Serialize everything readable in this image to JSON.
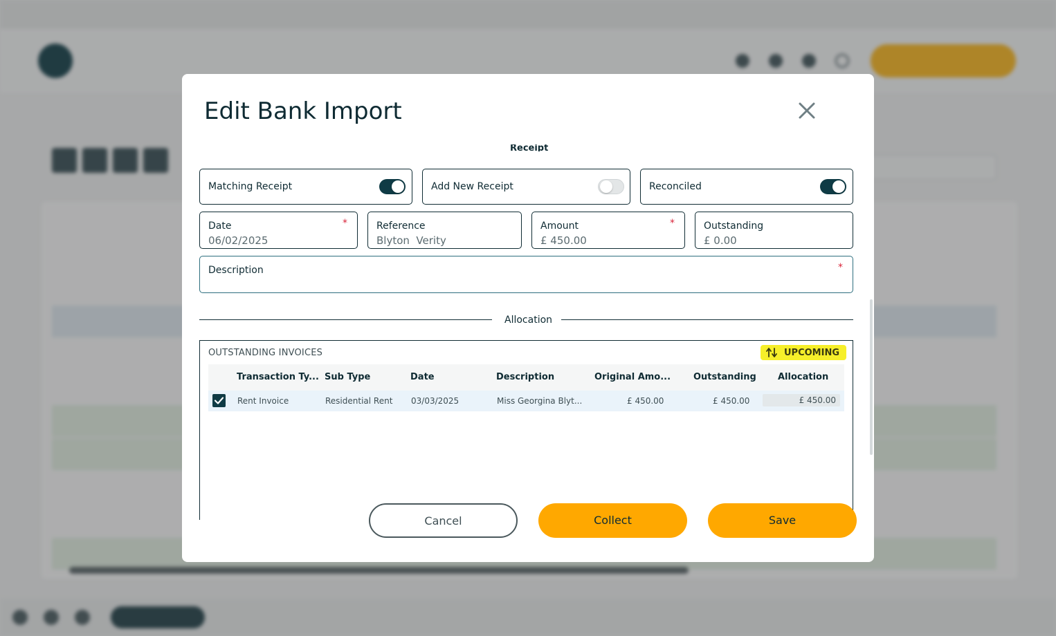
{
  "modal": {
    "title": "Edit Bank Import",
    "section_label": "Receipt",
    "toggles": {
      "matching_receipt": {
        "label": "Matching Receipt",
        "on": true
      },
      "add_new_receipt": {
        "label": "Add New Receipt",
        "on": false
      },
      "reconciled": {
        "label": "Reconciled",
        "on": true
      }
    },
    "fields": {
      "date": {
        "label": "Date",
        "value": "06/02/2025",
        "required": "*"
      },
      "reference": {
        "label": "Reference",
        "value": "Blyton  Verity"
      },
      "amount": {
        "label": "Amount",
        "value": "£ 450.00",
        "required": "*"
      },
      "outstanding": {
        "label": "Outstanding",
        "value": "£ 0.00"
      },
      "description": {
        "label": "Description",
        "value": "",
        "required": "*"
      }
    },
    "allocation_label": "Allocation",
    "invoices": {
      "title": "OUTSTANDING INVOICES",
      "badge": "UPCOMING",
      "columns": [
        "Transaction Ty...",
        "Sub Type",
        "Date",
        "Description",
        "Original Amo...",
        "Outstanding",
        "Allocation"
      ],
      "rows": [
        {
          "checked": true,
          "transaction_type": "Rent Invoice",
          "sub_type": "Residential Rent",
          "date": "03/03/2025",
          "description": "Miss Georgina Blyt...",
          "original_amount": "£ 450.00",
          "outstanding": "£ 450.00",
          "allocation": "£ 450.00"
        }
      ]
    },
    "buttons": {
      "cancel": "Cancel",
      "collect": "Collect",
      "save": "Save"
    }
  },
  "colors": {
    "accent": "#ffa800",
    "primary": "#0f3b45",
    "badge": "#f6ef2a",
    "required": "#d9263c"
  }
}
